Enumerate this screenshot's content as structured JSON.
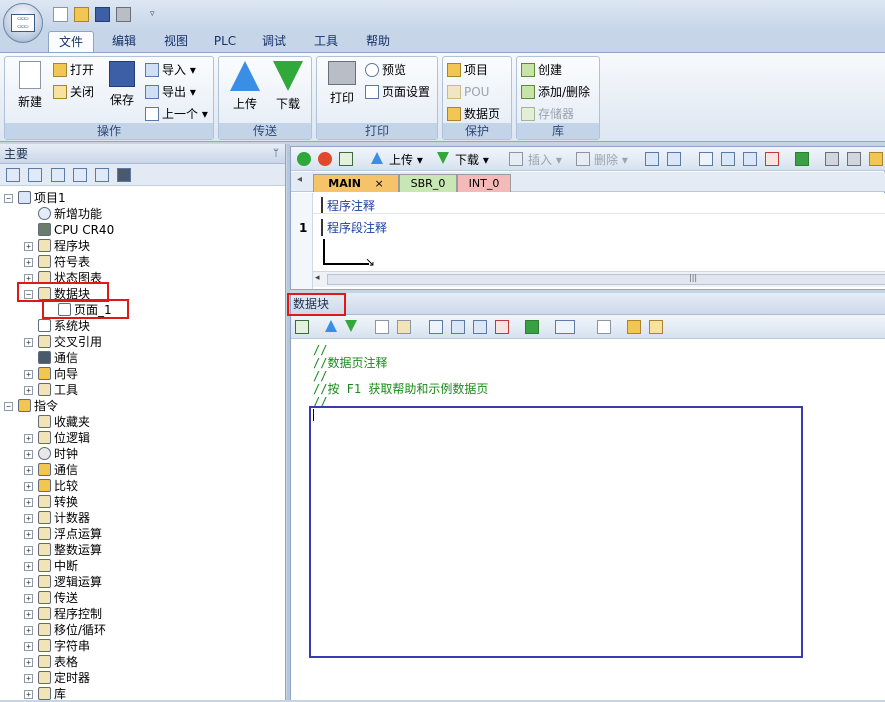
{
  "quick_access": {
    "icons": [
      "new-file-icon",
      "open-folder-icon",
      "save-icon",
      "print-icon"
    ],
    "dropdown": "▿"
  },
  "menu": {
    "tabs": [
      "文件",
      "编辑",
      "视图",
      "PLC",
      "调试",
      "工具",
      "帮助"
    ],
    "active": "文件"
  },
  "ribbon": {
    "groups": {
      "operation": "操作",
      "transfer": "传送",
      "print": "打印",
      "protect": "保护",
      "library": "库"
    },
    "new": "新建",
    "open": "打开",
    "close": "关闭",
    "save": "保存",
    "import": "导入",
    "export": "导出",
    "previous": "上一个",
    "upload": "上传",
    "download": "下载",
    "print_btn": "打印",
    "preview": "预览",
    "page_setup": "页面设置",
    "project": "项目",
    "pou": "POU",
    "data_page": "数据页",
    "create": "创建",
    "add_delete": "添加/删除",
    "memory": "存储器"
  },
  "left_pane": {
    "title": "主要",
    "pin": "ᛘ"
  },
  "tree": {
    "project": {
      "label": "项目1",
      "children": [
        "新增功能",
        "CPU CR40",
        "程序块",
        "符号表",
        "状态图表",
        "数据块",
        "页面_1",
        "系统块",
        "交叉引用",
        "通信",
        "向导",
        "工具"
      ]
    },
    "instructions": {
      "label": "指令",
      "children": [
        "收藏夹",
        "位逻辑",
        "时钟",
        "通信",
        "比较",
        "转换",
        "计数器",
        "浮点运算",
        "整数运算",
        "中断",
        "逻辑运算",
        "传送",
        "程序控制",
        "移位/循环",
        "字符串",
        "表格",
        "定时器",
        "库"
      ]
    }
  },
  "program_toolbar": {
    "upload": "上传",
    "download": "下载",
    "insert": "插入",
    "delete": "删除"
  },
  "program_tabs": [
    {
      "label": "MAIN",
      "close": "×",
      "color": "#f5c46a"
    },
    {
      "label": "SBR_0",
      "color": "#c9e7b4"
    },
    {
      "label": "INT_0",
      "color": "#f4b9b9"
    }
  ],
  "program": {
    "comment": "程序注释",
    "segment_number": "1",
    "segment_comment": "程序段注释"
  },
  "data_block": {
    "title": "数据块",
    "lines": [
      "//",
      "//数据页注释",
      "//",
      "//按 F1 获取帮助和示例数据页",
      "//"
    ]
  }
}
